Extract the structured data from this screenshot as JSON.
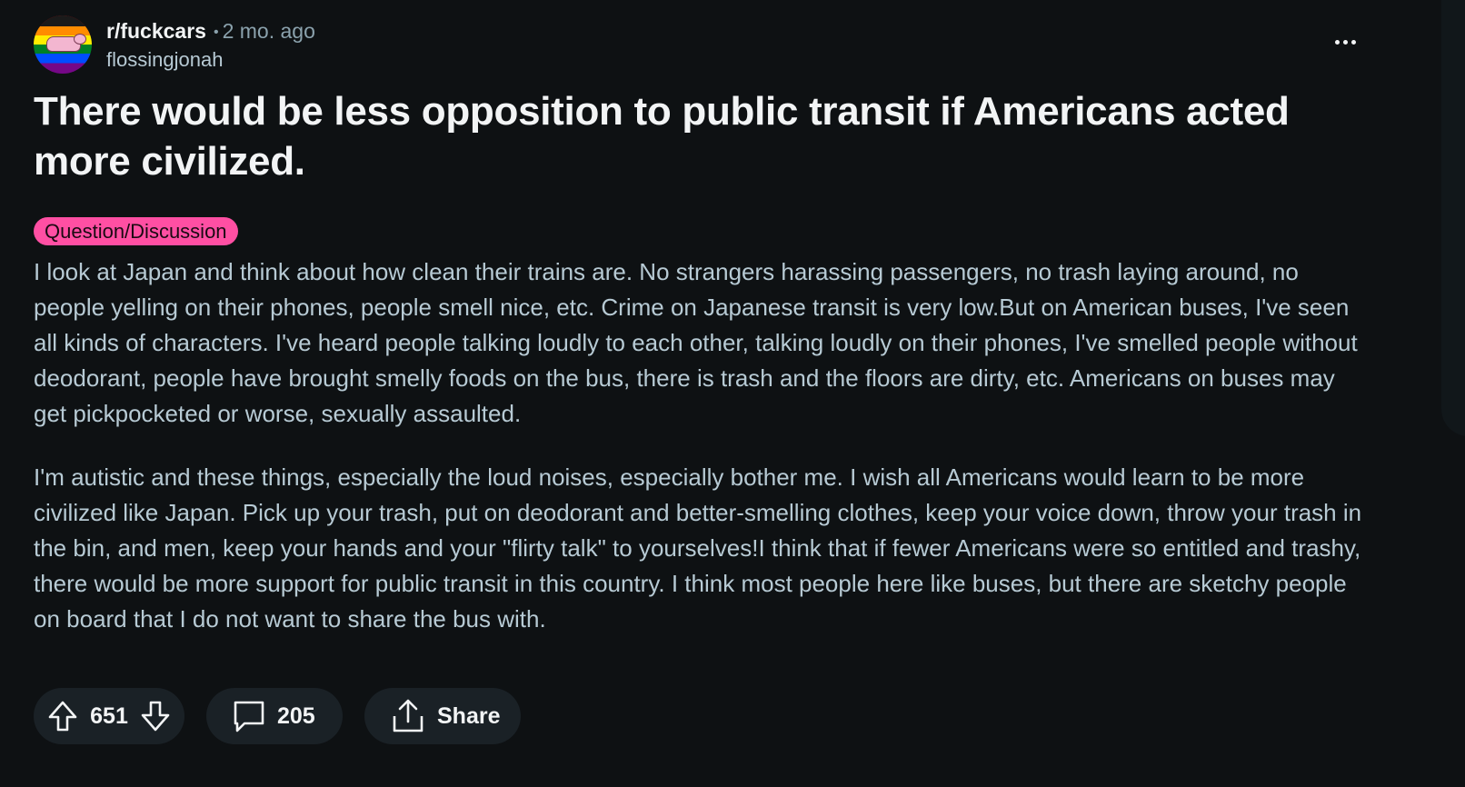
{
  "post": {
    "subreddit": "r/fuckcars",
    "separator": "•",
    "age": "2 mo. ago",
    "author": "flossingjonah",
    "title": "There would be less opposition to public transit if Americans acted more civilized.",
    "flair": "Question/Discussion",
    "paragraphs": [
      "I look at Japan and think about how clean their trains are. No strangers harassing passengers, no trash laying around, no people yelling on their phones, people smell nice, etc. Crime on Japanese transit is very low.But on American buses, I've seen all kinds of characters. I've heard people talking loudly to each other, talking loudly on their phones, I've smelled people without deodorant, people have brought smelly foods on the bus, there is trash and the floors are dirty, etc. Americans on buses may get pickpocketed or worse, sexually assaulted.",
      "I'm autistic and these things, especially the loud noises, especially bother me. I wish all Americans would learn to be more civilized like Japan. Pick up your trash, put on deodorant and better-smelling clothes, keep your voice down, throw your trash in the bin, and men, keep your hands and your \"flirty talk\" to yourselves!I think that if fewer Americans were so entitled and trashy, there would be more support for public transit in this country. I think most people here like buses, but there are sketchy people on board that I do not want to share the bus with."
    ]
  },
  "actions": {
    "score": "651",
    "comments": "205",
    "share_label": "Share"
  },
  "icons": {
    "avatar": "subreddit-avatar",
    "more": "more-options-icon",
    "upvote": "upvote-arrow-icon",
    "downvote": "downvote-arrow-icon",
    "comment": "comment-bubble-icon",
    "share": "share-icon"
  },
  "colors": {
    "background": "#0e1113",
    "title": "#f2f4f5",
    "body": "#b7cad4",
    "flair": "#ff4fa3",
    "pill": "#1a2126"
  }
}
